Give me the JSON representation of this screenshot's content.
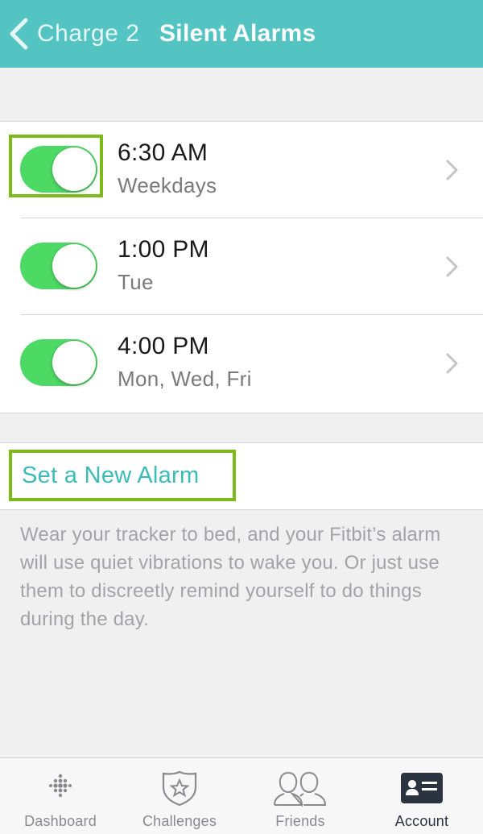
{
  "header": {
    "back_label": "Charge 2",
    "title": "Silent Alarms",
    "color": "#54c4c3"
  },
  "alarms": [
    {
      "time": "6:30 AM",
      "days": "Weekdays",
      "enabled": true
    },
    {
      "time": "1:00 PM",
      "days": "Tue",
      "enabled": true
    },
    {
      "time": "4:00 PM",
      "days": "Mon, Wed, Fri",
      "enabled": true
    }
  ],
  "new_alarm": {
    "label": "Set a New Alarm"
  },
  "info_text": "Wear your tracker to bed, and your Fitbit’s alarm will use quiet vibrations to wake you. Or just use them to discreetly remind yourself to do things during the day.",
  "tabs": [
    {
      "label": "Dashboard",
      "icon": "fitbit-dots-icon",
      "active": false
    },
    {
      "label": "Challenges",
      "icon": "star-badge-icon",
      "active": false
    },
    {
      "label": "Friends",
      "icon": "friends-icon",
      "active": false
    },
    {
      "label": "Account",
      "icon": "account-card-icon",
      "active": true
    }
  ],
  "colors": {
    "toggle_on": "#4cd964",
    "highlight": "#7cba1a",
    "link": "#3bbcb8"
  }
}
